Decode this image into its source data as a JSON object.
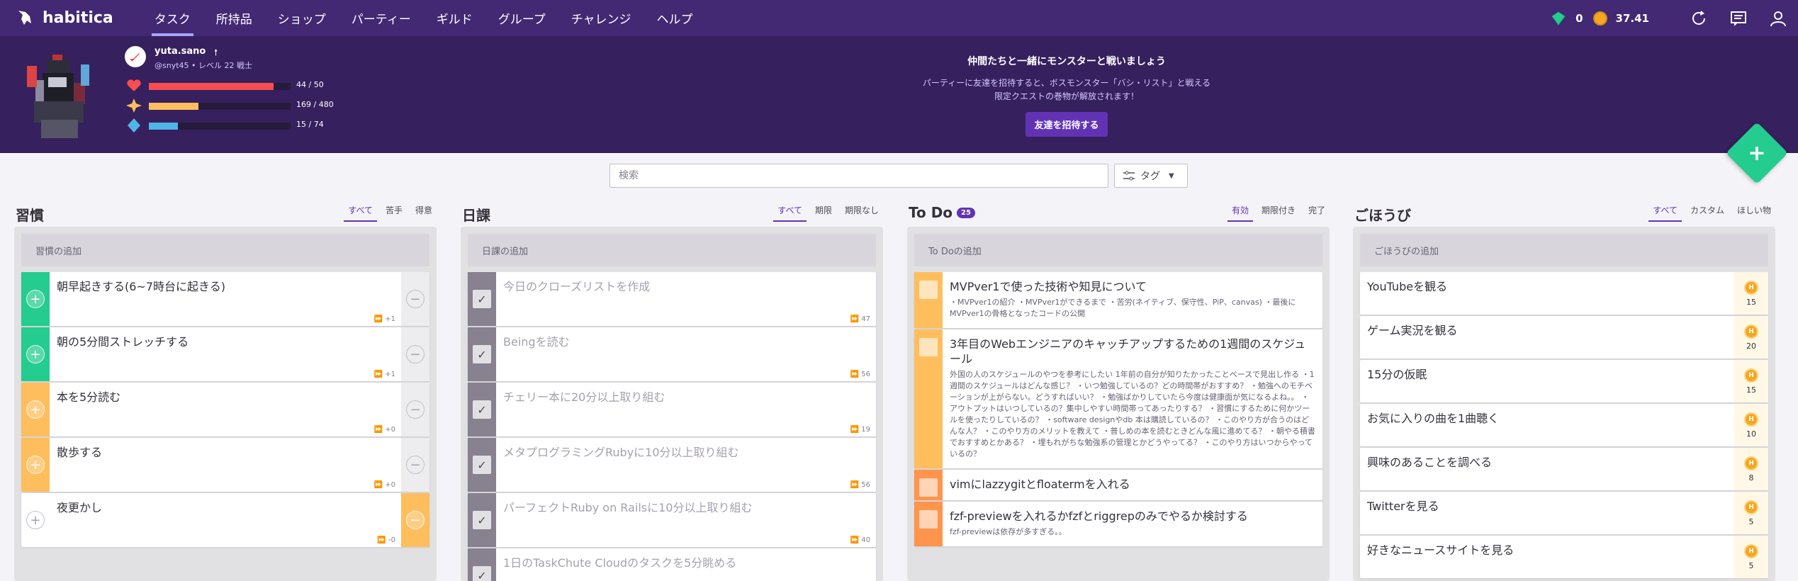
{
  "nav": {
    "logo": "habitica",
    "items": [
      "タスク",
      "所持品",
      "ショップ",
      "パーティー",
      "ギルド",
      "グループ",
      "チャレンジ",
      "ヘルプ"
    ],
    "active_index": 0,
    "gems": "0",
    "gold": "37.41"
  },
  "user": {
    "name": "yuta.sano",
    "handle_line": "@snyt45 • レベル 22 戦士",
    "hp": {
      "text": "44 / 50",
      "fraction": 0.88,
      "color": "#f74e52"
    },
    "exp": {
      "text": "169 / 480",
      "fraction": 0.352,
      "color": "#ffbe5d"
    },
    "mp": {
      "text": "15 / 74",
      "fraction": 0.203,
      "color": "#50b5e9"
    }
  },
  "party": {
    "title": "仲間たちと一緒にモンスターと戦いましょう",
    "desc1": "パーティーに友達を招待すると、ボスモンスター「バシ・リスト」と戦える",
    "desc2": "限定クエストの巻物が解放されます！",
    "button": "友達を招待する"
  },
  "search": {
    "placeholder": "検索"
  },
  "tag_button": "タグ",
  "habits": {
    "title": "習慣",
    "filters": [
      "すべて",
      "苦手",
      "得意"
    ],
    "add": "習慣の追加",
    "items": [
      {
        "text": "朝早起きする(6~7時台に起きる)",
        "streak": "⏩ +1",
        "color": "#24cc8f"
      },
      {
        "text": "朝の5分間ストレッチする",
        "streak": "⏩ +1",
        "color": "#24cc8f"
      },
      {
        "text": "本を5分読む",
        "streak": "⏩ +0",
        "color": "#ffbe5d"
      },
      {
        "text": "散歩する",
        "streak": "⏩ +0",
        "color": "#ffbe5d"
      },
      {
        "text": "夜更かし",
        "streak": "⏩ -0",
        "color": "#ffbe5d"
      }
    ]
  },
  "dailies": {
    "title": "日課",
    "filters": [
      "すべて",
      "期限",
      "期限なし"
    ],
    "add": "日課の追加",
    "items": [
      {
        "text": "今日のクローズリストを作成",
        "streak": "⏩ 47"
      },
      {
        "text": "Beingを読む",
        "streak": "⏩ 56"
      },
      {
        "text": "チェリー本に20分以上取り組む",
        "streak": "⏩ 19"
      },
      {
        "text": "メタプログラミングRubyに10分以上取り組む",
        "streak": "⏩ 56"
      },
      {
        "text": "パーフェクトRuby on Railsに10分以上取り組む",
        "streak": "⏩ 40"
      },
      {
        "text": "1日のTaskChute Cloudのタスクを5分眺める",
        "streak": ""
      }
    ]
  },
  "todos": {
    "title": "To Do",
    "count": "25",
    "filters": [
      "有効",
      "期限付き",
      "完了"
    ],
    "add": "To Doの追加",
    "items": [
      {
        "text": "MVPver1で使った技術や知見について",
        "notes": "・MVPver1の紹介 ・MVPver1ができるまで ・苦労(ネイティブ、保守性、PiP、canvas) ・最後にMVPver1の骨格となったコードの公開",
        "color": "#ffbe5d"
      },
      {
        "text": "3年目のWebエンジニアのキャッチアップするための1週間のスケジュール",
        "notes": "外国の人のスケジュールのやつを参考にしたい 1年前の自分が知りたかったことベースで見出し作る ・1週間のスケジュールはどんな感じ？ ・いつ勉強しているの？どの時間帯がおすすめ？ ・勉強へのモチベーションが上がらない。どうすればいい？ ・勉強ばかりしていたら今度は健康面が気になるよね。。 ・アウトプットはいつしているの？集中しやすい時間帯ってあったりする？ ・習慣にするために何かツールを使ったりしているの？ ・software designやdb 本は購読しているの？ ・このやり方が合うのはどんな人？ ・このやり方のメリットを教えて ・普しめの本を読むときどんな風に進めてる？ ・朝やる積書でおすすめとかある？ ・埋もれがちな勉強系の管理とかどうやってる？ ・このやり方はいつからやっているの？",
        "color": "#ffbe5d"
      },
      {
        "text": "vimにlazzygitとfloatermを入れる",
        "notes": "",
        "color": "#ff944c"
      },
      {
        "text": "fzf-previewを入れるかfzfとriggrepのみでやるか検討する",
        "notes": "fzf-previewは依存が多すぎる。。",
        "color": "#ff944c"
      }
    ]
  },
  "rewards": {
    "title": "ごほうび",
    "filters": [
      "すべて",
      "カスタム",
      "ほしい物"
    ],
    "add": "ごほうびの追加",
    "items": [
      {
        "text": "YouTubeを観る",
        "price": "15"
      },
      {
        "text": "ゲーム実況を観る",
        "price": "20"
      },
      {
        "text": "15分の仮眠",
        "price": "15"
      },
      {
        "text": "お気に入りの曲を1曲聴く",
        "price": "10"
      },
      {
        "text": "興味のあることを調べる",
        "price": "8"
      },
      {
        "text": "Twitterを見る",
        "price": "5"
      },
      {
        "text": "好きなニュースサイトを見る",
        "price": "5"
      }
    ]
  }
}
